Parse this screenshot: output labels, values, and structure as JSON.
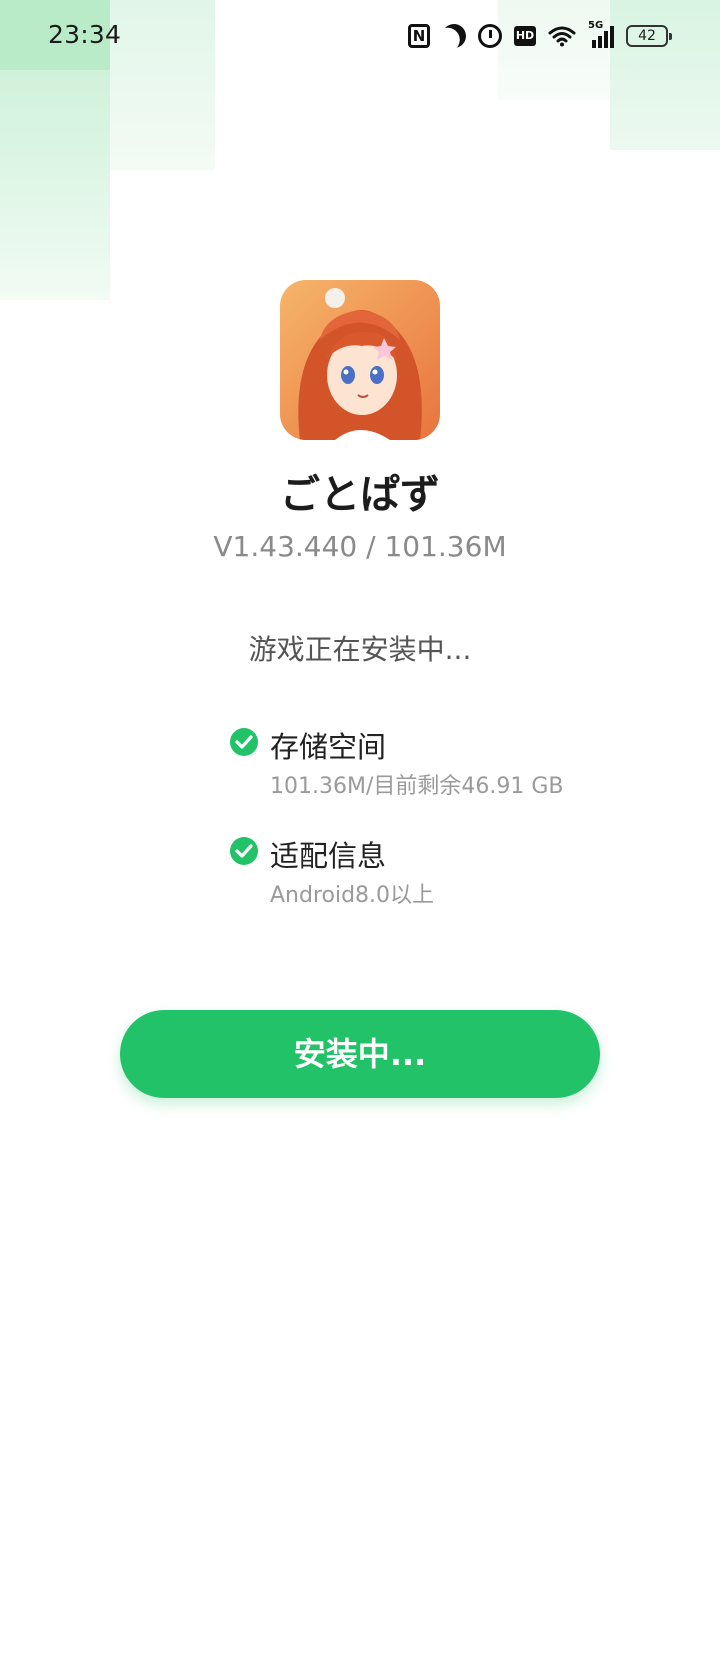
{
  "status_bar": {
    "time": "23:34",
    "nfc_label": "N",
    "hd_label": "HD",
    "network_label": "5G",
    "battery_level": "42",
    "icons": [
      "nfc-icon",
      "moon-icon",
      "alarm-icon",
      "hd-icon",
      "wifi-icon",
      "signal-icon",
      "battery-icon"
    ]
  },
  "app": {
    "name": "ごとぱず",
    "meta": "V1.43.440  /  101.36M"
  },
  "install": {
    "status_text": "游戏正在安装中...",
    "checks": [
      {
        "title": "存储空间",
        "desc": "101.36M/目前剩余46.91 GB"
      },
      {
        "title": "适配信息",
        "desc": "Android8.0以上"
      }
    ],
    "button_label": "安装中..."
  },
  "colors": {
    "accent": "#22c268",
    "muted_text": "#9a9a9a"
  }
}
